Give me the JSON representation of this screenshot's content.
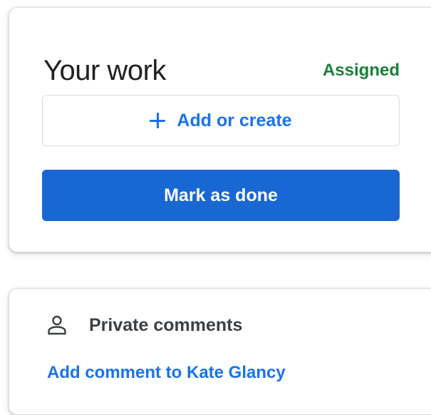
{
  "work": {
    "title": "Your work",
    "status": "Assigned",
    "add_label": "Add or create",
    "done_label": "Mark as done"
  },
  "comments": {
    "title": "Private comments",
    "add_link": "Add comment to Kate Glancy"
  },
  "colors": {
    "status_green": "#188038",
    "primary_blue": "#1967d2",
    "link_blue": "#1a73e8"
  },
  "icons": {
    "add": "plus-icon",
    "comments": "person-icon"
  }
}
